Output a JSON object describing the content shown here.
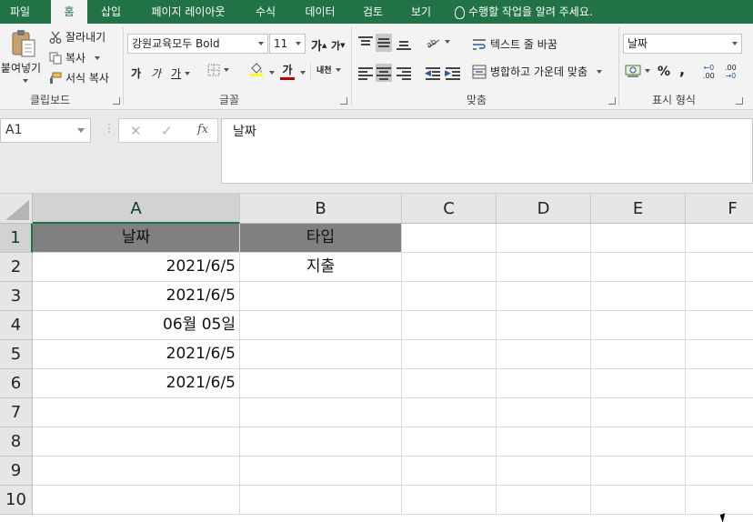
{
  "tabs": [
    {
      "label": "파일"
    },
    {
      "label": "홈",
      "active": true
    },
    {
      "label": "삽입"
    },
    {
      "label": "페이지 레이아웃"
    },
    {
      "label": "수식"
    },
    {
      "label": "데이터"
    },
    {
      "label": "검토"
    },
    {
      "label": "보기"
    }
  ],
  "tell_me": "수행할 작업을 알려 주세요.",
  "ribbon": {
    "clipboard": {
      "paste_label": "붙여넣기",
      "cut_label": "잘라내기",
      "copy_label": "복사",
      "format_painter_label": "서식 복사",
      "group_label": "클립보드"
    },
    "font": {
      "font_name": "강원교육모두 Bold",
      "font_size": "11",
      "grow_font": "가",
      "shrink_font": "가",
      "bold": "가",
      "italic": "가",
      "underline": "가",
      "font_color": "가",
      "phonetic": "내천",
      "group_label": "글꼴"
    },
    "alignment": {
      "wrap_text_label": "텍스트 줄 바꿈",
      "merge_center_label": "병합하고 가운데 맞춤",
      "group_label": "맞춤"
    },
    "number": {
      "format": "날짜",
      "percent": "%",
      "comma": ",",
      "inc_decimal": ".00",
      "dec_decimal": ".00",
      "group_label": "표시 형식"
    },
    "accent_color": "#217346"
  },
  "formula_bar": {
    "name_box": "A1",
    "cancel": "✕",
    "enter": "✓",
    "fx": "fx",
    "formula": "날짜"
  },
  "sheet": {
    "columns": [
      "A",
      "B",
      "C",
      "D",
      "E",
      "F"
    ],
    "rows": [
      "1",
      "2",
      "3",
      "4",
      "5",
      "6",
      "7",
      "8",
      "9",
      "10"
    ],
    "header_fill": "#808080",
    "cells": {
      "A1": "날짜",
      "B1": "타입",
      "A2": "2021/6/5",
      "B2": "지출",
      "A3": "2021/6/5",
      "A4": "06월 05일",
      "A5": "2021/6/5",
      "A6": "2021/6/5"
    }
  }
}
